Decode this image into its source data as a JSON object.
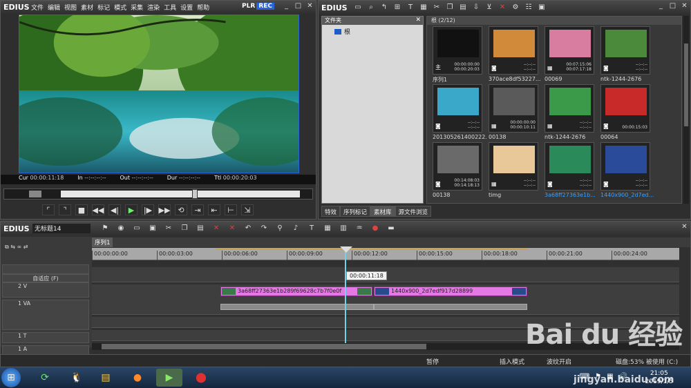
{
  "player": {
    "logo": "EDIUS",
    "menus": [
      "文件",
      "编辑",
      "视图",
      "素材",
      "标记",
      "模式",
      "采集",
      "渲染",
      "工具",
      "设置",
      "帮助"
    ],
    "plr": "PLR",
    "rec": "REC",
    "timecode": {
      "cur_label": "Cur",
      "cur": "00:00:11:18",
      "in_label": "In",
      "in": "--:--:--:--",
      "out_label": "Out",
      "out": "--:--:--:--",
      "dur_label": "Dur",
      "dur": "--:--:--:--",
      "ttl_label": "Ttl",
      "ttl": "00:00:20:03"
    },
    "scrub_position": 0.56
  },
  "bin": {
    "logo": "EDIUS",
    "folder_header": "文件夹",
    "root_label": "根",
    "asset_header": "根 (2/12)",
    "assets": [
      {
        "name": "序列1",
        "type": "sequence",
        "dur": "00:00:00:00\n00:00:20:03",
        "color": "#111111"
      },
      {
        "name": "370ace8df53227...",
        "type": "image",
        "dur": "--:--:--\n--:--:--",
        "color": "#d08a3a"
      },
      {
        "name": "00069",
        "type": "video",
        "dur": "00:07:15:06\n00:07:17:18",
        "color": "#d87ca0"
      },
      {
        "name": "ntk-1244-2676",
        "type": "image",
        "dur": "--:--:--\n--:--:--",
        "color": "#4a8a3a"
      },
      {
        "name": "201305261400222...",
        "type": "image",
        "dur": "--:--:--\n--:--:--",
        "color": "#3aa8c8"
      },
      {
        "name": "00138",
        "type": "video",
        "dur": "00:00:00:00\n00:00:10:11",
        "color": "#5a5a5a"
      },
      {
        "name": "ntk-1244-2676",
        "type": "video",
        "dur": "--:--:--\n--:--:--",
        "color": "#3a9a4a"
      },
      {
        "name": "00064",
        "type": "image",
        "dur": "00:00:15:03",
        "color": "#c82a2a"
      },
      {
        "name": "00138",
        "type": "image",
        "dur": "00:14:08:03\n00:14:18:13",
        "color": "#6a6a6a"
      },
      {
        "name": "timg",
        "type": "video",
        "dur": "--:--:--\n--:--:--",
        "color": "#e8c898"
      },
      {
        "name": "3a68ff27363e1b...",
        "type": "image",
        "dur": "--:--:--\n--:--:--",
        "color": "#2a8a5a",
        "selected": true
      },
      {
        "name": "1440x900_2d7ed...",
        "type": "image",
        "dur": "--:--:--\n--:--:--",
        "color": "#2a4a9a",
        "selected": true
      }
    ],
    "tabs": [
      "特效",
      "序列标记",
      "素材库",
      "源文件浏览"
    ]
  },
  "timeline": {
    "logo": "EDIUS",
    "project": "无标题14",
    "sequence_tab": "序列1",
    "auto_label": "自适应 (F)",
    "tracks": [
      "2 V",
      "1 VA",
      "1 T",
      "1 A"
    ],
    "ruler_ticks": [
      "00:00:00:00",
      "00:00:03:00",
      "00:00:06:00",
      "00:00:09:00",
      "00:00:12:00",
      "00:00:15:00",
      "00:00:18:00",
      "00:00:21:00",
      "00:00:24:00"
    ],
    "playhead_tc": "00:00:11:18",
    "clips": [
      {
        "name": "3a68ff27363e1b289f69628c7b7f0e0f"
      },
      {
        "name": "1440x900_2d7edf917d28899"
      }
    ],
    "status": {
      "pause": "暂停",
      "insert_mode": "插入模式",
      "ripple": "波纹开启",
      "disk": "磁盘:53% 被使用 (C:)"
    }
  },
  "taskbar": {
    "time": "21:05",
    "date": "2019/1/5"
  },
  "watermark": {
    "brand": "Bai du 经验",
    "url": "jingyan.baidu.com"
  }
}
